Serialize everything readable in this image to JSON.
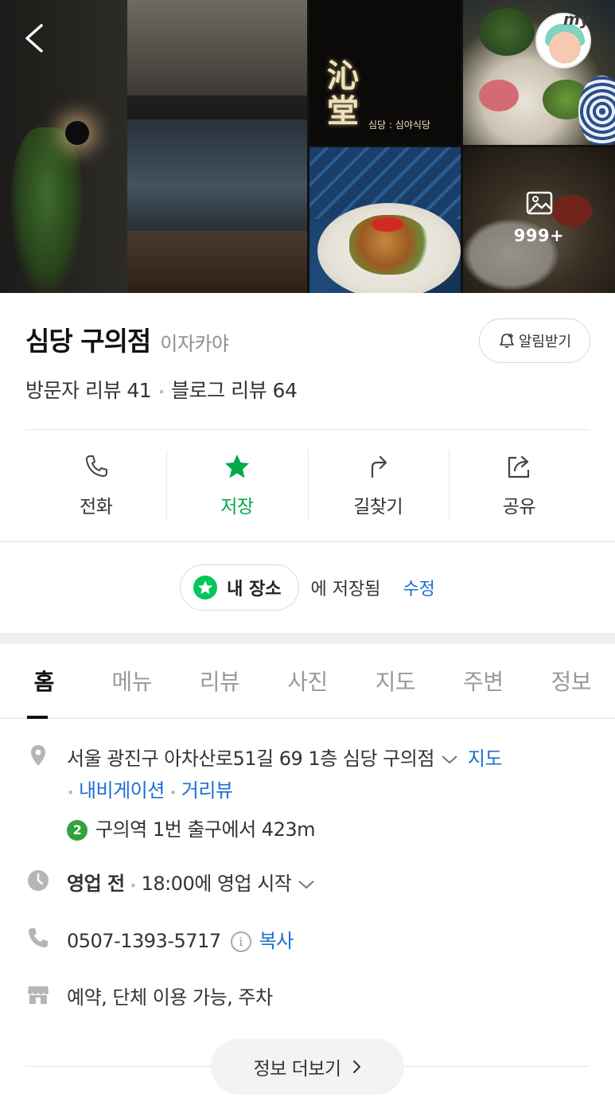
{
  "header": {
    "sign_title": "沁\n堂",
    "sign_subtitle": "심당 : 심야식당",
    "photo_count": "999+",
    "my_label": "my"
  },
  "place": {
    "name": "심당 구의점",
    "category": "이자카야",
    "notify_label": "알림받기",
    "visitor_review_label": "방문자 리뷰 41",
    "blog_review_label": "블로그 리뷰 64"
  },
  "actions": [
    {
      "label": "전화",
      "icon": "phone-icon"
    },
    {
      "label": "저장",
      "icon": "star-icon"
    },
    {
      "label": "길찾기",
      "icon": "directions-icon"
    },
    {
      "label": "공유",
      "icon": "share-icon"
    }
  ],
  "saved": {
    "chip_label": "내 장소",
    "text": "에 저장됨",
    "edit_label": "수정"
  },
  "tabs": [
    "홈",
    "메뉴",
    "리뷰",
    "사진",
    "지도",
    "주변",
    "정보"
  ],
  "info": {
    "address": "서울 광진구 아차산로51길 69 1층 심당 구의점",
    "map_link": "지도",
    "navigation_link": "내비게이션",
    "street_view_link": "거리뷰",
    "subway_line": "2",
    "subway_text": "구의역 1번 출구에서 423m",
    "hours_status": "영업 전",
    "hours_text": "18:00에 영업 시작",
    "phone": "0507-1393-5717",
    "copy_label": "복사",
    "facilities": "예약, 단체 이용 가능, 주차",
    "more_label": "정보 더보기"
  },
  "colors": {
    "accent_green": "#03c75a",
    "link_blue": "#1b6fd3",
    "subway_line2": "#33a23d"
  }
}
